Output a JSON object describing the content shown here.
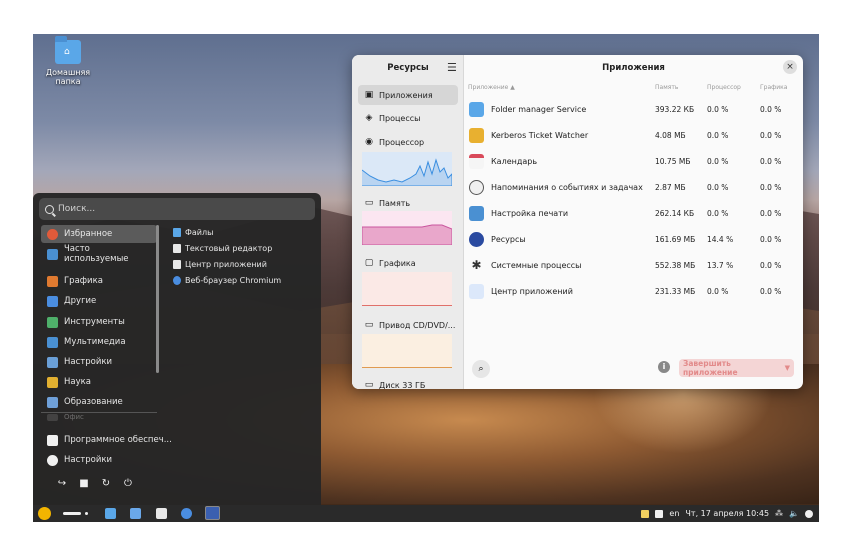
{
  "desktop": {
    "home_folder_label": "Домашняя папка"
  },
  "start_menu": {
    "search_placeholder": "Поиск...",
    "categories": [
      {
        "label": "Избранное",
        "icon": "heart-icon",
        "color": "#e05a3a"
      },
      {
        "label": "Часто используемые",
        "icon": "frequent-icon",
        "color": "#4a90d2"
      },
      {
        "label": "Графика",
        "icon": "graphics-icon",
        "color": "#e07a30"
      },
      {
        "label": "Другие",
        "icon": "other-apps-icon",
        "color": "#4a8de0"
      },
      {
        "label": "Инструменты",
        "icon": "tools-icon",
        "color": "#4fb06a"
      },
      {
        "label": "Мультимедиа",
        "icon": "multimedia-icon",
        "color": "#4a90d2"
      },
      {
        "label": "Настройки",
        "icon": "settings-category-icon",
        "color": "#6a9fd6"
      },
      {
        "label": "Наука",
        "icon": "science-icon",
        "color": "#e2b030"
      },
      {
        "label": "Образование",
        "icon": "education-icon",
        "color": "#6fa0d8"
      },
      {
        "label": "Офис",
        "icon": "office-icon",
        "color": "#777777"
      }
    ],
    "apps": [
      {
        "label": "Файлы",
        "icon": "files-icon",
        "color": "#5aa7e8"
      },
      {
        "label": "Текстовый редактор",
        "icon": "text-editor-icon",
        "color": "#e8e8e8"
      },
      {
        "label": "Центр приложений",
        "icon": "app-center-icon",
        "color": "#e8e8e8"
      },
      {
        "label": "Веб-браузер Chromium",
        "icon": "chromium-icon",
        "color": "#4a8de0"
      }
    ],
    "bottom_items": [
      {
        "label": "Программное обеспеч...",
        "icon": "software-icon"
      },
      {
        "label": "Настройки",
        "icon": "settings-gear-icon"
      }
    ],
    "power_icons": [
      "logout-icon",
      "lock-icon",
      "restart-icon",
      "power-icon"
    ]
  },
  "resources": {
    "sidebar_title": "Ресурсы",
    "main_title": "Приложения",
    "sidebar_items": [
      {
        "label": "Приложения",
        "icon": "apps-list-icon"
      },
      {
        "label": "Процессы",
        "icon": "processes-icon"
      },
      {
        "label": "Процессор",
        "icon": "cpu-icon"
      },
      {
        "label": "Память",
        "icon": "memory-icon"
      },
      {
        "label": "Графика",
        "icon": "gpu-icon"
      },
      {
        "label": "Привод CD/DVD/...",
        "icon": "drive-icon"
      },
      {
        "label": "Диск 33 ГБ",
        "icon": "disk-icon"
      }
    ],
    "graph_colors": {
      "cpu": "#3a8ee0",
      "memory": "#c9559e",
      "gpu": "#e0706a",
      "drive": "#e09a50"
    },
    "columns": {
      "name": "Приложение",
      "memory": "Память",
      "cpu": "Процессор",
      "gpu": "Графика"
    },
    "rows": [
      {
        "name": "Folder manager Service",
        "memory": "393.22 КБ",
        "cpu": "0.0 %",
        "gpu": "0.0 %",
        "icon": "folder-manager-icon",
        "color": "#5aa7e8"
      },
      {
        "name": "Kerberos Ticket Watcher",
        "memory": "4.08 МБ",
        "cpu": "0.0 %",
        "gpu": "0.0 %",
        "icon": "kerberos-lock-icon",
        "color": "#e8b030"
      },
      {
        "name": "Календарь",
        "memory": "10.75 МБ",
        "cpu": "0.0 %",
        "gpu": "0.0 %",
        "icon": "calendar-icon",
        "color": "#d94a5a"
      },
      {
        "name": "Напоминания о событиях и задачах",
        "memory": "2.87 МБ",
        "cpu": "0.0 %",
        "gpu": "0.0 %",
        "icon": "reminder-clock-icon",
        "color": "#cccccc"
      },
      {
        "name": "Настройка печати",
        "memory": "262.14 КБ",
        "cpu": "0.0 %",
        "gpu": "0.0 %",
        "icon": "printer-icon",
        "color": "#4a90d2"
      },
      {
        "name": "Ресурсы",
        "memory": "161.69 МБ",
        "cpu": "14.4 %",
        "gpu": "0.0 %",
        "icon": "resources-gauge-icon",
        "color": "#2a4aa0"
      },
      {
        "name": "Системные процессы",
        "memory": "552.38 МБ",
        "cpu": "13.7 %",
        "gpu": "0.0 %",
        "icon": "system-processes-icon",
        "color": "#333333"
      },
      {
        "name": "Центр приложений",
        "memory": "231.33 МБ",
        "cpu": "0.0 %",
        "gpu": "0.0 %",
        "icon": "app-center-icon",
        "color": "#6a9fe0"
      }
    ],
    "end_app_label": "Завершить приложение"
  },
  "taskbar": {
    "language": "en",
    "datetime": "Чт, 17 апреля 10:45"
  }
}
